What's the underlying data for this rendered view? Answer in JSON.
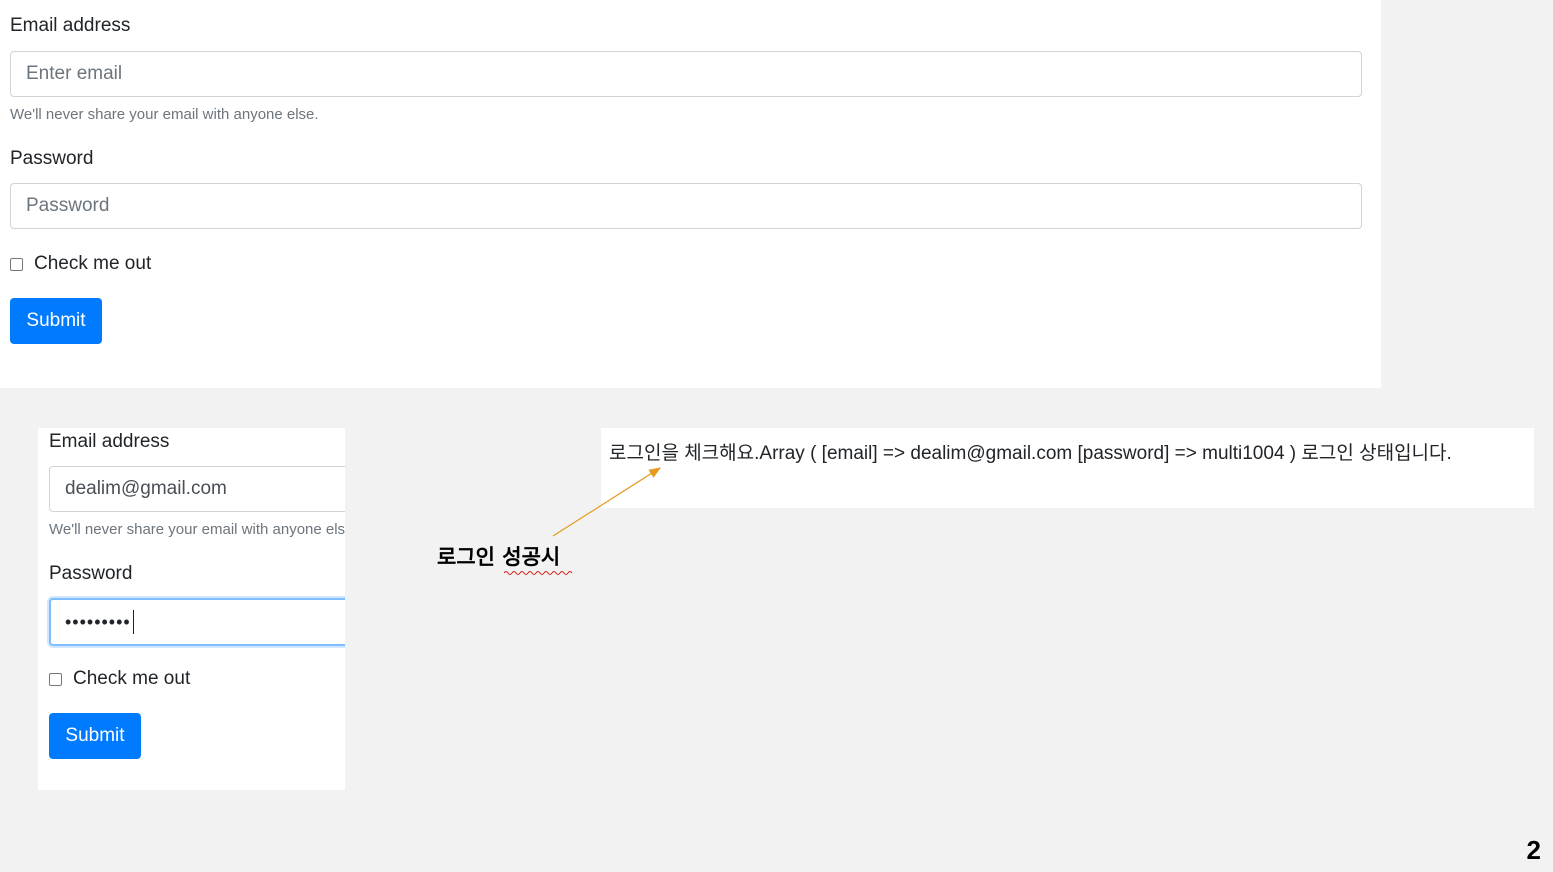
{
  "top_form": {
    "email_label": "Email address",
    "email_placeholder": "Enter email",
    "email_help": "We'll never share your email with anyone else.",
    "password_label": "Password",
    "password_placeholder": "Password",
    "checkbox_label": "Check me out",
    "submit_label": "Submit"
  },
  "bottom_form": {
    "email_label": "Email address",
    "email_value": "dealim@gmail.com",
    "email_help": "We'll never share your email with anyone else.",
    "password_label": "Password",
    "password_masked": "•••••••••",
    "checkbox_label": "Check me out",
    "submit_label": "Submit"
  },
  "result": {
    "text": "로그인을 체크해요.Array ( [email] => dealim@gmail.com [password] => multi1004 ) 로그인 상태입니다."
  },
  "annotation": {
    "text": "로그인 성공시"
  },
  "page_number": "2",
  "colors": {
    "primary": "#007bff",
    "focus_border": "#80bdff",
    "arrow": "#e69a1f",
    "background": "#f2f2f2"
  }
}
